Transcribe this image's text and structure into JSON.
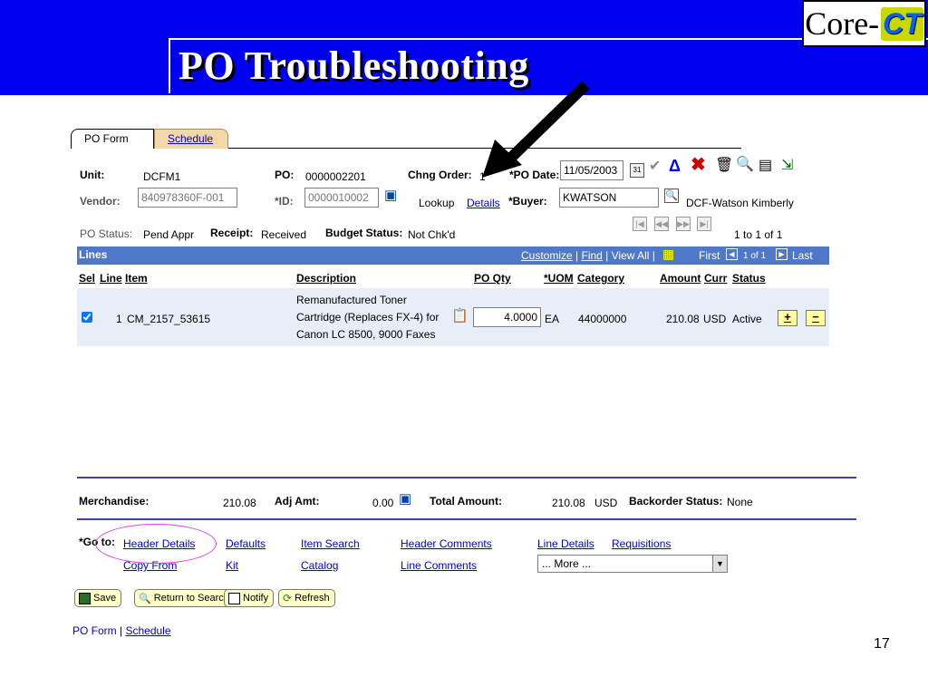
{
  "slide": {
    "title": "PO Troubleshooting",
    "page_number": "17",
    "logo": {
      "core": "Core-",
      "ct": "CT"
    }
  },
  "tabs": [
    {
      "label": "PO Form"
    },
    {
      "label": "Schedule"
    }
  ],
  "header": {
    "unit_label": "Unit:",
    "unit_value": "DCFM1",
    "po_label": "PO:",
    "po_value": "0000002201",
    "chng_order_label": "Chng Order:",
    "chng_order_value": "1",
    "po_date_label": "*PO Date:",
    "po_date_value": "11/05/2003",
    "vendor_label": "Vendor:",
    "vendor_value": "840978360F-001",
    "id_label": "*ID:",
    "id_value": "0000010002",
    "lookup_label": "Lookup",
    "details_link": "Details",
    "buyer_label": "*Buyer:",
    "buyer_value": "KWATSON",
    "buyer_name": "DCF-Watson Kimberly",
    "po_status_label": "PO Status:",
    "po_status_value": "Pend Appr",
    "receipt_label": "Receipt:",
    "receipt_value": "Received",
    "budget_status_label": "Budget Status:",
    "budget_status_value": "Not Chk'd",
    "pager_text": "1 to 1 of 1"
  },
  "lines": {
    "title": "Lines",
    "customize": "Customize",
    "find": "Find",
    "view_all": "View All",
    "first": "First",
    "page": "1 of 1",
    "last": "Last",
    "columns": [
      "Sel",
      "Line",
      "Item",
      "Description",
      "PO Qty",
      "*UOM",
      "Category",
      "Amount",
      "Curr",
      "Status"
    ],
    "row": {
      "line": "1",
      "item": "CM_2157_53615",
      "description_1": "Remanufactured Toner",
      "description_2": "Cartridge (Replaces FX-4) for",
      "description_3": "Canon LC 8500, 9000 Faxes",
      "qty": "4.0000",
      "uom": "EA",
      "category": "44000000",
      "amount": "210.08",
      "curr": "USD",
      "status": "Active"
    },
    "plus_label": "+",
    "minus_label": "−"
  },
  "totals": {
    "merchandise_label": "Merchandise:",
    "merchandise_value": "210.08",
    "adj_amt_label": "Adj Amt:",
    "adj_amt_value": "0.00",
    "total_amount_label": "Total Amount:",
    "total_amount_value": "210.08",
    "total_currency": "USD",
    "backorder_label": "Backorder Status:",
    "backorder_value": "None"
  },
  "goto": {
    "label": "*Go to:",
    "links": {
      "header_details": "Header Details",
      "copy_from": "Copy From",
      "defaults": "Defaults",
      "kit": "Kit",
      "item_search": "Item Search",
      "catalog": "Catalog",
      "header_comments": "Header Comments",
      "line_comments": "Line Comments",
      "line_details": "Line Details",
      "requisitions": "Requisitions"
    },
    "more_select": "... More ..."
  },
  "buttons": {
    "save": "Save",
    "return_to_search": "Return to Search",
    "notify": "Notify",
    "refresh": "Refresh"
  },
  "footer_links": {
    "po_form": "PO Form",
    "separator": "|",
    "schedule": "Schedule"
  },
  "colors": {
    "slide_blue": "#0000f0",
    "grid_header": "#5078c8",
    "link_blue": "#0000cc",
    "highlight": "#e040e0"
  }
}
